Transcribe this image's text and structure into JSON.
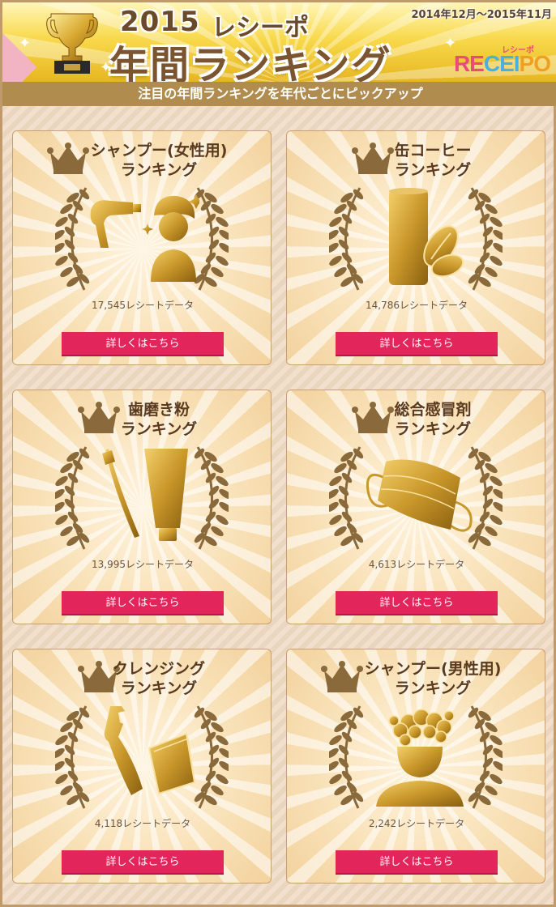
{
  "header": {
    "year": "2015",
    "brand_kana": "レシーポ",
    "title": "年間ランキング",
    "period": "2014年12月～2015年11月",
    "logo_small": "レシーポ",
    "logo": "RECEIPO"
  },
  "subbar": {
    "text": "注目の年間ランキングを年代ごとにピックアップ"
  },
  "cards": [
    {
      "title_line1": "シャンプー(女性用)",
      "title_line2": "ランキング",
      "count": "17,545レシートデータ",
      "button": "詳しくはこちら",
      "icon": "hairdryer-woman-icon"
    },
    {
      "title_line1": "缶コーヒー",
      "title_line2": "ランキング",
      "count": "14,786レシートデータ",
      "button": "詳しくはこちら",
      "icon": "coffee-can-icon"
    },
    {
      "title_line1": "歯磨き粉",
      "title_line2": "ランキング",
      "count": "13,995レシートデータ",
      "button": "詳しくはこちら",
      "icon": "toothpaste-icon"
    },
    {
      "title_line1": "総合感冒剤",
      "title_line2": "ランキング",
      "count": "4,613レシートデータ",
      "button": "詳しくはこちら",
      "icon": "mask-icon"
    },
    {
      "title_line1": "クレンジング",
      "title_line2": "ランキング",
      "count": "4,118レシートデータ",
      "button": "詳しくはこちら",
      "icon": "cleansing-bottle-icon"
    },
    {
      "title_line1": "シャンプー(男性用)",
      "title_line2": "ランキング",
      "count": "2,242レシートデータ",
      "button": "詳しくはこちら",
      "icon": "man-shampoo-icon"
    }
  ],
  "colors": {
    "accent_button": "#e2255a",
    "gold": "#c9972a",
    "bar": "#b08c4f"
  }
}
